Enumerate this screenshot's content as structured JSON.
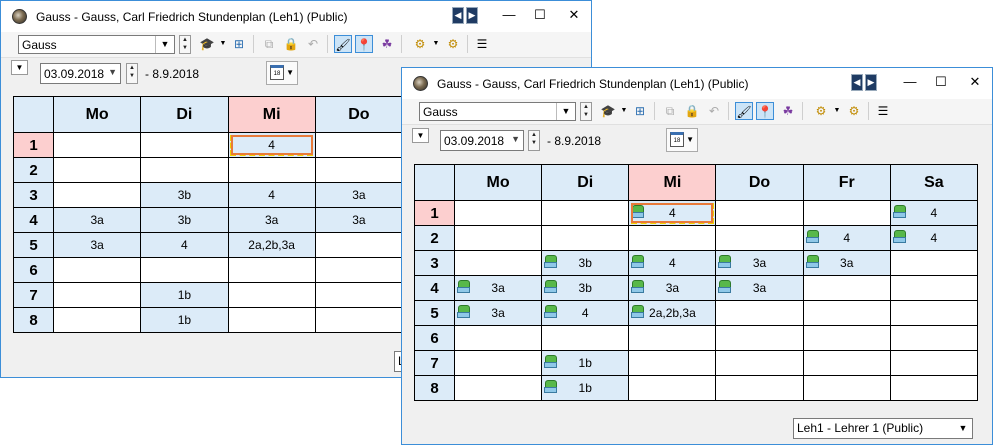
{
  "back_window": {
    "title": "Gauss - Gauss, Carl Friedrich  Stundenplan  (Leh1) (Public)",
    "teacher_combo": "Gauss",
    "date_from": "03.09.2018",
    "date_to": "- 8.9.2018",
    "days": [
      "Mo",
      "Di",
      "Mi",
      "Do"
    ],
    "today_index": 2,
    "periods": [
      "1",
      "2",
      "3",
      "4",
      "5",
      "6",
      "7",
      "8"
    ],
    "rows": [
      [
        "",
        "",
        "4",
        ""
      ],
      [
        "",
        "",
        "",
        ""
      ],
      [
        "",
        "3b",
        "4",
        "3a"
      ],
      [
        "3a",
        "3b",
        "3a",
        "3a"
      ],
      [
        "3a",
        "4",
        "2a,2b,3a",
        ""
      ],
      [
        "",
        "",
        "",
        ""
      ],
      [
        "",
        "1b",
        "",
        ""
      ],
      [
        "",
        "1b",
        "",
        ""
      ]
    ],
    "status_text": "Le"
  },
  "front_window": {
    "title": "Gauss - Gauss, Carl Friedrich  Stundenplan  (Leh1) (Public)",
    "teacher_combo": "Gauss",
    "date_from": "03.09.2018",
    "date_to": "- 8.9.2018",
    "days": [
      "Mo",
      "Di",
      "Mi",
      "Do",
      "Fr",
      "Sa"
    ],
    "today_index": 2,
    "periods": [
      "1",
      "2",
      "3",
      "4",
      "5",
      "6",
      "7",
      "8"
    ],
    "rows": [
      [
        "",
        "",
        "4",
        "",
        "",
        "4"
      ],
      [
        "",
        "",
        "",
        "",
        "4",
        "4"
      ],
      [
        "",
        "3b",
        "4",
        "3a",
        "3a",
        ""
      ],
      [
        "3a",
        "3b",
        "3a",
        "3a",
        "",
        ""
      ],
      [
        "3a",
        "4",
        "2a,2b,3a",
        "",
        "",
        ""
      ],
      [
        "",
        "",
        "",
        "",
        "",
        ""
      ],
      [
        "",
        "1b",
        "",
        "",
        "",
        ""
      ],
      [
        "",
        "1b",
        "",
        "",
        "",
        ""
      ]
    ],
    "status_combo": "Leh1 - Lehrer 1 (Public)"
  },
  "icons": {
    "nav_prev": "◀",
    "nav_next": "▶",
    "minimize": "—",
    "maximize": "☐",
    "close": "✕",
    "dropdown": "▼",
    "chevron": "﹀",
    "spin_up": "▲",
    "spin_down": "▼",
    "cap": "🎓",
    "grid": "⊞",
    "copy": "⧉",
    "lock": "🔒",
    "undo": "↶",
    "brush": "🖌",
    "pin": "📍",
    "people": "☘",
    "settings": "⚙",
    "gear": "⚙",
    "menu": "☰",
    "calendar": "18"
  },
  "colors": {
    "window_border": "#3c8ed8",
    "cell_filled": "#dcebf8",
    "today_header": "#fccfcf",
    "selection_dash": "#f2d100",
    "selection_border": "#e87a3a"
  }
}
